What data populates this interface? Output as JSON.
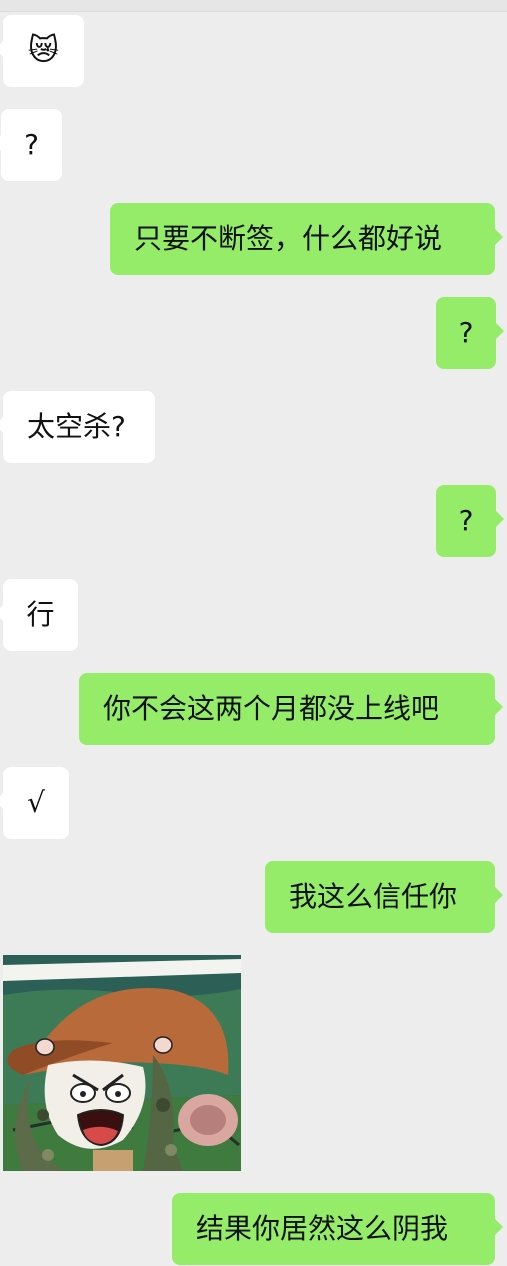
{
  "messages": [
    {
      "side": "in",
      "text": "😿"
    },
    {
      "side": "in",
      "text": "?"
    },
    {
      "side": "out",
      "text": "只要不断签，什么都好说"
    },
    {
      "side": "out",
      "text": "?"
    },
    {
      "side": "in",
      "text": "太空杀?"
    },
    {
      "side": "out",
      "text": "?"
    },
    {
      "side": "in",
      "text": "行"
    },
    {
      "side": "out",
      "text": "你不会这两个月都没上线吧"
    },
    {
      "side": "in",
      "text": "√"
    },
    {
      "side": "out",
      "text": "我这么信任你"
    },
    {
      "side": "in",
      "type": "sticker",
      "sticker": "screaming-cartoon-mouse-in-camo-with-cap"
    },
    {
      "side": "out",
      "text": "结果你居然这么阴我"
    }
  ],
  "colors": {
    "background": "#ededed",
    "incoming": "#ffffff",
    "outgoing": "#95ec69"
  }
}
